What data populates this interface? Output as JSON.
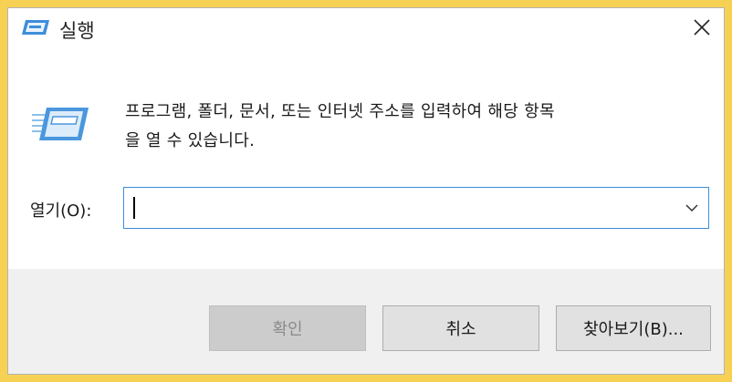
{
  "window": {
    "title": "실행",
    "icon": "run-dialog-icon",
    "close_icon": "close-icon"
  },
  "description": {
    "line1": "프로그램, 폴더, 문서, 또는 인터넷 주소를 입력하여 해당 항목",
    "line2": "을 열 수 있습니다."
  },
  "open_field": {
    "label": "열기(O):",
    "value": "",
    "dropdown_icon": "chevron-down-icon"
  },
  "buttons": {
    "ok": "확인",
    "cancel": "취소",
    "browse": "찾아보기(B)..."
  },
  "colors": {
    "background": "#f7d154",
    "dialog": "#ffffff",
    "footer": "#f0f0f0",
    "input_border": "#3c8ddb",
    "disabled_button": "#cccccc",
    "button": "#e1e1e1"
  }
}
